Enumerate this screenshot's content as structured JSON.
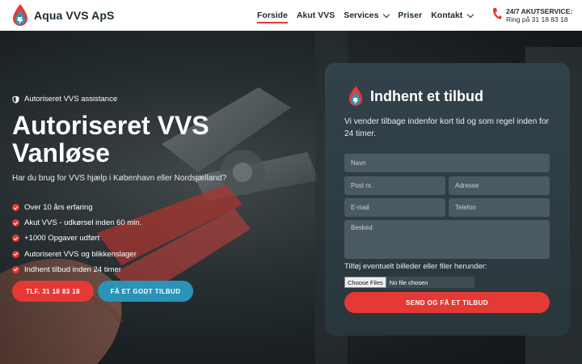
{
  "header": {
    "brand": "Aqua VVS ApS",
    "nav": [
      {
        "label": "Forside",
        "active": true,
        "dropdown": false
      },
      {
        "label": "Akut VVS",
        "active": false,
        "dropdown": false
      },
      {
        "label": "Services",
        "active": false,
        "dropdown": true
      },
      {
        "label": "Priser",
        "active": false,
        "dropdown": false
      },
      {
        "label": "Kontakt",
        "active": false,
        "dropdown": true
      }
    ],
    "emergency_line1": "24/7 AKUTSERVICE:",
    "emergency_line2": "Ring på 31 18 83 18"
  },
  "hero": {
    "badge": "Autoriseret VVS assistance",
    "title_line1": "Autoriseret VVS",
    "title_line2": "Vanløse",
    "subtitle": "Har du brug for VVS hjælp i København eller Nordsjælland?",
    "checklist": [
      "Over 10 års erfaring",
      "Akut VVS - udkørsel inden 60 min.",
      "+1000 Opgaver udført",
      "Autoriseret VVS og blikkenslager",
      "Indhent tilbud inden 24 timer"
    ],
    "button_phone": "TLF. 31 18 83 18",
    "button_offer": "FÅ ET GODT TILBUD"
  },
  "form": {
    "title": "Indhent et tilbud",
    "description": "Vi vender tilbage indenfor kort tid og som regel inden for 24 timer.",
    "placeholders": {
      "name": "Navn",
      "postal": "Post nr.",
      "address": "Adresse",
      "email": "E-mail",
      "phone": "Telefon",
      "message": "Besked"
    },
    "files_label": "Tilføj eventuelt billeder eller filer herunder:",
    "choose_files": "Choose Files",
    "no_file": "No file chosen",
    "submit": "SEND OG FÅ ET TILBUD"
  },
  "colors": {
    "accent_red": "#e53935",
    "accent_blue": "#2b93b8",
    "dark_text": "#1b2b34",
    "card_bg": "#2d3a40"
  },
  "icons": {
    "logo": "water-drop-flame-icon",
    "phone": "phone-icon",
    "badge": "shield-icon",
    "check": "check-circle-icon"
  }
}
